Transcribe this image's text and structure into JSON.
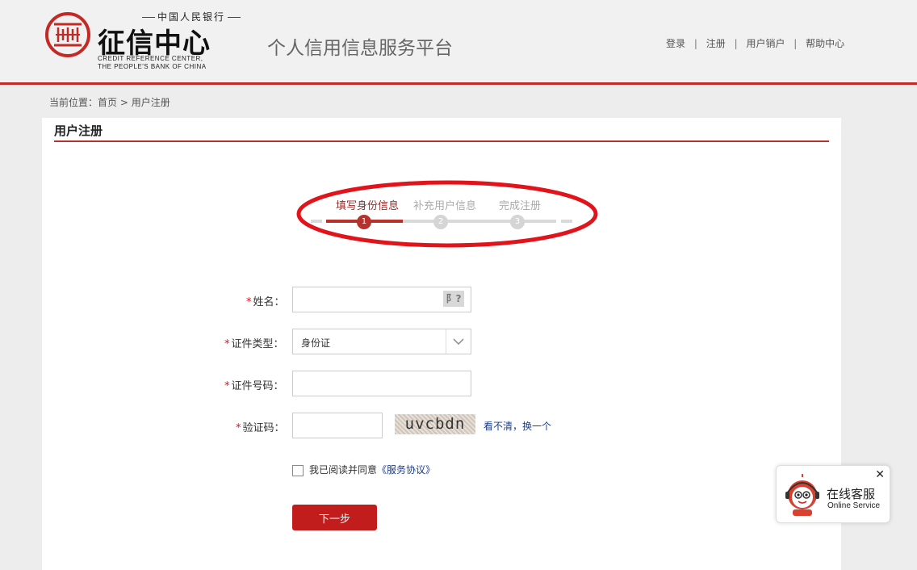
{
  "header": {
    "logo": {
      "small_cn": "中国人民银行",
      "big_cn": "征信中心",
      "en_line1": "CREDIT REFERENCE CENTER,",
      "en_line2": "THE PEOPLE'S BANK OF CHINA"
    },
    "platform_title": "个人信用信息服务平台",
    "nav": {
      "login": "登录",
      "register": "注册",
      "cancel_account": "用户销户",
      "help": "帮助中心",
      "separator": "|"
    }
  },
  "breadcrumb": {
    "prefix": "当前位置：",
    "home": "首页",
    "arrow": ">",
    "current": "用户注册"
  },
  "panel": {
    "title": "用户注册"
  },
  "steps": [
    {
      "label": "填写身份信息",
      "number": "1",
      "state": "active"
    },
    {
      "label": "补充用户信息",
      "number": "2",
      "state": "todo"
    },
    {
      "label": "完成注册",
      "number": "3",
      "state": "todo"
    }
  ],
  "form": {
    "required_mark": "*",
    "name_label": "姓名：",
    "name_value": "",
    "keyboard_icon_text": "阝?",
    "id_type_label": "证件类型：",
    "id_type_value": "身份证",
    "id_number_label": "证件号码：",
    "id_number_value": "",
    "captcha_label": "验证码：",
    "captcha_value": "",
    "captcha_text": "uvcbdn",
    "captcha_unclear": "看不清",
    "captcha_comma": "，",
    "captcha_refresh": "换一个",
    "agree_text": "我已阅读并同意",
    "agree_link": "《服务协议》",
    "agree_checked": false,
    "next_button": "下一步"
  },
  "chat_widget": {
    "title": "在线客服",
    "subtitle": "Online Service",
    "close": "✕"
  },
  "colors": {
    "brand_red": "#c32a26",
    "button_red": "#c21d1d",
    "link_blue": "#1a3d8f",
    "annotation_red": "#e0141a"
  }
}
